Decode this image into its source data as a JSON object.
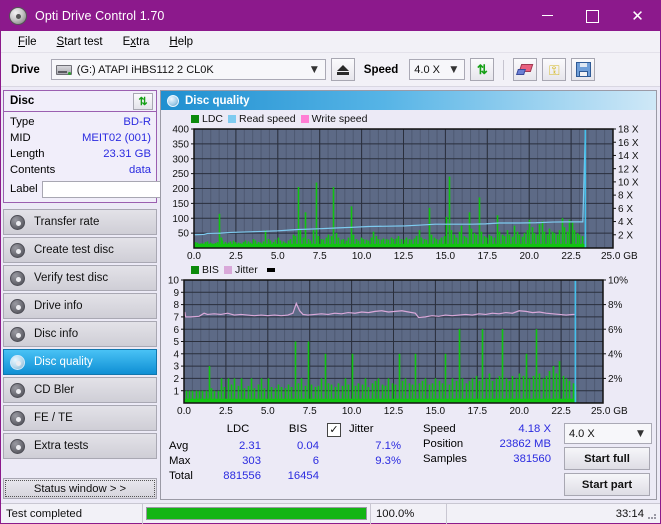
{
  "window": {
    "title": "Opti Drive Control 1.70",
    "icon": "disc-icon",
    "buttons": {
      "minimize": "minimize-icon",
      "maximize": "maximize-icon",
      "close": "✕"
    }
  },
  "menu": {
    "items": [
      "File",
      "Start test",
      "Extra",
      "Help"
    ]
  },
  "toolbar": {
    "drive_label": "Drive",
    "drive_value": "(G:)  ATAPI iHBS112  2 CL0K",
    "eject_icon": "eject-icon",
    "speed_label": "Speed",
    "speed_value": "4.0 X",
    "refresh_icon": "refresh-icon",
    "eraser_icon": "eraser-icon",
    "keys_icon": "keys-icon",
    "save_icon": "save-icon"
  },
  "sidebar": {
    "disc_panel": {
      "title": "Disc",
      "refresh_icon": "refresh-icon",
      "rows": [
        {
          "key": "Type",
          "value": "BD-R"
        },
        {
          "key": "MID",
          "value": "MEIT02 (001)"
        },
        {
          "key": "Length",
          "value": "23.31 GB"
        },
        {
          "key": "Contents",
          "value": "data"
        }
      ],
      "label_key": "Label",
      "label_value": "",
      "label_placeholder": "",
      "label_button_icon": "disc-icon"
    },
    "nav": [
      {
        "label": "Transfer rate",
        "active": false
      },
      {
        "label": "Create test disc",
        "active": false
      },
      {
        "label": "Verify test disc",
        "active": false
      },
      {
        "label": "Drive info",
        "active": false
      },
      {
        "label": "Disc info",
        "active": false
      },
      {
        "label": "Disc quality",
        "active": true
      },
      {
        "label": "CD Bler",
        "active": false
      },
      {
        "label": "FE / TE",
        "active": false
      },
      {
        "label": "Extra tests",
        "active": false
      }
    ],
    "status_window_button": "Status window > >"
  },
  "main": {
    "header_title": "Disc quality",
    "header_icon": "disc-quality-icon"
  },
  "stats": {
    "col_headers": [
      "LDC",
      "BIS"
    ],
    "jitter_label": "Jitter",
    "jitter_checked": true,
    "jitter_check_glyph": "✓",
    "rows": [
      {
        "label": "Avg",
        "ldc": "2.31",
        "bis": "0.04",
        "jitter": "7.1%"
      },
      {
        "label": "Max",
        "ldc": "303",
        "bis": "6",
        "jitter": "9.3%"
      },
      {
        "label": "Total",
        "ldc": "881556",
        "bis": "16454",
        "jitter": ""
      }
    ],
    "speed_label": "Speed",
    "speed_value": "4.18 X",
    "position_label": "Position",
    "position_value": "23862 MB",
    "samples_label": "Samples",
    "samples_value": "381560",
    "speed_select": "4.0 X",
    "start_full": "Start full",
    "start_part": "Start part"
  },
  "statusbar": {
    "message": "Test completed",
    "percent_text": "100.0%",
    "progress": 100,
    "elapsed": "33:14"
  },
  "colors": {
    "titlebar": "#8c198c",
    "accent_blue": "#2b2be0",
    "ldc_green": "#11c411",
    "read_speed": "#7ecbf0",
    "write_speed": "#ff7ed4",
    "jitter_pink": "#d9a8d9",
    "plot_bg": "#5d6a86",
    "progress_green": "#14b514"
  },
  "chart_data": [
    {
      "type": "line",
      "name": "ldc-chart",
      "title": "",
      "legend": [
        {
          "label": "LDC",
          "color": "#0c8a0c"
        },
        {
          "label": "Read speed",
          "color": "#7ecbf0"
        },
        {
          "label": "Write speed",
          "color": "#ff7ed4"
        }
      ],
      "legend_position": "top-left",
      "xlabel": "GB",
      "ylabel": "LDC",
      "y2label": "X",
      "xlim": [
        0,
        25
      ],
      "ylim": [
        0,
        400
      ],
      "y2lim": [
        0,
        18
      ],
      "xticks": [
        0.0,
        2.5,
        5.0,
        7.5,
        10.0,
        12.5,
        15.0,
        17.5,
        20.0,
        22.5,
        25.0
      ],
      "xticklabels": [
        "0.0",
        "2.5",
        "5.0",
        "7.5",
        "10.0",
        "12.5",
        "15.0",
        "17.5",
        "20.0",
        "22.5",
        "25.0 GB"
      ],
      "yticks": [
        50,
        100,
        150,
        200,
        250,
        300,
        350,
        400
      ],
      "y2ticks": [
        2,
        4,
        6,
        8,
        10,
        12,
        14,
        16,
        18
      ],
      "y2ticklabels": [
        "2 X",
        "4 X",
        "6 X",
        "8 X",
        "10 X",
        "12 X",
        "14 X",
        "16 X",
        "18 X"
      ],
      "grid": true,
      "series": [
        {
          "name": "LDC",
          "kind": "impulse",
          "color": "#11c411",
          "x": [
            0.05,
            0.2,
            0.35,
            0.5,
            0.65,
            0.8,
            0.95,
            1.1,
            1.25,
            1.4,
            1.5,
            1.6,
            1.7,
            1.85,
            2.0,
            2.15,
            2.3,
            2.45,
            2.6,
            2.75,
            2.9,
            3.05,
            3.2,
            3.35,
            3.5,
            3.65,
            3.8,
            3.95,
            4.1,
            4.25,
            4.4,
            4.55,
            4.7,
            4.85,
            5.0,
            5.15,
            5.3,
            5.45,
            5.6,
            5.75,
            5.9,
            6.05,
            6.2,
            6.35,
            6.5,
            6.65,
            6.8,
            6.95,
            7.1,
            7.25,
            7.4,
            7.55,
            7.7,
            7.85,
            8.0,
            8.15,
            8.3,
            8.45,
            8.6,
            8.75,
            8.9,
            9.05,
            9.2,
            9.35,
            9.5,
            9.65,
            9.8,
            9.95,
            10.1,
            10.25,
            10.4,
            10.55,
            10.7,
            10.85,
            11.0,
            11.15,
            11.3,
            11.45,
            11.6,
            11.75,
            11.9,
            12.05,
            12.2,
            12.35,
            12.5,
            12.65,
            12.8,
            12.95,
            13.1,
            13.25,
            13.4,
            13.55,
            13.7,
            13.85,
            14.0,
            14.15,
            14.3,
            14.45,
            14.6,
            14.75,
            14.9,
            15.05,
            15.2,
            15.35,
            15.5,
            15.65,
            15.8,
            15.95,
            16.1,
            16.25,
            16.4,
            16.55,
            16.7,
            16.85,
            17.0,
            17.15,
            17.3,
            17.45,
            17.6,
            17.75,
            17.9,
            18.05,
            18.2,
            18.35,
            18.5,
            18.65,
            18.8,
            18.95,
            19.1,
            19.25,
            19.4,
            19.55,
            19.7,
            19.85,
            20.0,
            20.15,
            20.3,
            20.45,
            20.6,
            20.75,
            20.9,
            21.05,
            21.2,
            21.35,
            21.5,
            21.65,
            21.8,
            21.95,
            22.1,
            22.25,
            22.4,
            22.55,
            22.7,
            22.85,
            23.0,
            23.15,
            23.3
          ],
          "y": [
            20,
            18,
            15,
            16,
            20,
            22,
            18,
            15,
            17,
            20,
            115,
            35,
            25,
            20,
            18,
            22,
            25,
            20,
            18,
            16,
            20,
            25,
            22,
            18,
            30,
            25,
            20,
            18,
            22,
            60,
            30,
            25,
            20,
            28,
            35,
            25,
            22,
            18,
            25,
            30,
            45,
            40,
            205,
            60,
            35,
            120,
            30,
            25,
            60,
            220,
            40,
            30,
            28,
            35,
            45,
            40,
            205,
            50,
            35,
            28,
            30,
            25,
            35,
            140,
            45,
            30,
            25,
            35,
            30,
            28,
            25,
            35,
            55,
            40,
            30,
            28,
            32,
            30,
            28,
            35,
            30,
            32,
            40,
            30,
            28,
            35,
            30,
            28,
            32,
            40,
            60,
            35,
            30,
            28,
            135,
            45,
            35,
            30,
            28,
            35,
            40,
            105,
            240,
            60,
            45,
            35,
            55,
            75,
            40,
            35,
            120,
            65,
            50,
            45,
            170,
            55,
            40,
            35,
            45,
            40,
            35,
            110,
            55,
            45,
            40,
            60,
            45,
            38,
            75,
            55,
            45,
            38,
            50,
            60,
            95,
            70,
            50,
            45,
            80,
            90,
            55,
            45,
            65,
            55,
            50,
            45,
            60,
            100,
            70,
            55,
            95,
            85,
            60,
            50,
            45,
            40,
            35
          ]
        },
        {
          "name": "Read speed",
          "kind": "line",
          "color": "#7ecbf0",
          "axis": "y2",
          "x": [
            0.0,
            0.6,
            0.8,
            1.6,
            2.2,
            3.4,
            5.0,
            6.2,
            7.4,
            8.6,
            9.6,
            10.4,
            11.6,
            12.6,
            13.4,
            14.4,
            15.6,
            16.6,
            17.4,
            18.2,
            19.4,
            20.4,
            21.4,
            22.2,
            23.2,
            23.35
          ],
          "y": [
            2.0,
            2.05,
            2.2,
            2.25,
            2.35,
            2.45,
            2.6,
            2.8,
            2.9,
            3.05,
            3.15,
            3.25,
            3.3,
            3.35,
            3.45,
            3.6,
            3.6,
            3.6,
            3.65,
            3.78,
            3.78,
            3.82,
            3.92,
            3.95,
            3.95,
            18.0
          ]
        }
      ],
      "cursor_x": 23.35,
      "cursor_color": "#45c0ea"
    },
    {
      "type": "line",
      "name": "bis-jitter-chart",
      "title": "",
      "legend": [
        {
          "label": "BIS",
          "color": "#0c8a0c"
        },
        {
          "label": "Jitter",
          "color": "#d9a8d9"
        }
      ],
      "legend_position": "top-left",
      "xlabel": "GB",
      "ylabel": "BIS",
      "y2label": "%",
      "xlim": [
        0,
        25
      ],
      "ylim": [
        0,
        10
      ],
      "y2lim": [
        0,
        10
      ],
      "xticks": [
        0.0,
        2.5,
        5.0,
        7.5,
        10.0,
        12.5,
        15.0,
        17.5,
        20.0,
        22.5,
        25.0
      ],
      "xticklabels": [
        "0.0",
        "2.5",
        "5.0",
        "7.5",
        "10.0",
        "12.5",
        "15.0",
        "17.5",
        "20.0",
        "22.5",
        "25.0 GB"
      ],
      "yticks": [
        1,
        2,
        3,
        4,
        5,
        6,
        7,
        8,
        9,
        10
      ],
      "y2ticks": [
        2,
        4,
        6,
        8,
        10
      ],
      "y2ticklabels": [
        "2%",
        "4%",
        "6%",
        "8%",
        "10%"
      ],
      "grid": true,
      "series": [
        {
          "name": "BIS",
          "kind": "impulse",
          "color": "#11c411",
          "x": [
            0.1,
            0.3,
            0.5,
            0.7,
            0.9,
            1.1,
            1.3,
            1.5,
            1.6,
            1.8,
            2.0,
            2.2,
            2.4,
            2.6,
            2.8,
            3.0,
            3.2,
            3.4,
            3.6,
            3.8,
            4.0,
            4.2,
            4.4,
            4.6,
            4.8,
            5.0,
            5.2,
            5.4,
            5.6,
            5.8,
            6.0,
            6.2,
            6.4,
            6.6,
            6.8,
            7.0,
            7.2,
            7.4,
            7.6,
            7.8,
            8.0,
            8.2,
            8.4,
            8.6,
            8.8,
            9.0,
            9.2,
            9.4,
            9.6,
            9.8,
            10.0,
            10.2,
            10.4,
            10.6,
            10.8,
            11.0,
            11.2,
            11.4,
            11.6,
            11.8,
            12.0,
            12.2,
            12.4,
            12.6,
            12.8,
            13.0,
            13.2,
            13.4,
            13.6,
            13.8,
            14.0,
            14.2,
            14.4,
            14.6,
            14.8,
            15.0,
            15.2,
            15.4,
            15.6,
            15.8,
            16.0,
            16.2,
            16.4,
            16.6,
            16.8,
            17.0,
            17.2,
            17.4,
            17.6,
            17.8,
            18.0,
            18.2,
            18.4,
            18.6,
            18.8,
            19.0,
            19.2,
            19.4,
            19.6,
            19.8,
            20.0,
            20.2,
            20.4,
            20.6,
            20.8,
            21.0,
            21.2,
            21.4,
            21.6,
            21.8,
            22.0,
            22.2,
            22.4,
            22.6,
            22.8,
            23.0,
            23.2,
            23.3
          ],
          "y": [
            1.0,
            1.0,
            1.0,
            1.0,
            1.0,
            1.0,
            1.0,
            3.0,
            1.2,
            1.0,
            1.0,
            2.0,
            1.3,
            2.0,
            1.5,
            2.0,
            1.4,
            2.0,
            1.2,
            1.4,
            2.0,
            1.2,
            1.5,
            2.0,
            1.2,
            2.0,
            1.3,
            1.2,
            1.5,
            1.3,
            1.2,
            1.5,
            1.3,
            5.0,
            1.6,
            2.0,
            1.4,
            5.0,
            1.5,
            1.3,
            1.4,
            2.0,
            4.0,
            1.6,
            1.5,
            1.3,
            1.6,
            1.4,
            2.0,
            1.5,
            4.0,
            1.4,
            1.6,
            1.5,
            2.0,
            1.3,
            1.6,
            1.8,
            2.0,
            1.5,
            1.4,
            2.0,
            1.6,
            1.5,
            4.0,
            1.8,
            2.0,
            1.6,
            1.5,
            4.0,
            1.6,
            1.8,
            2.0,
            1.5,
            1.6,
            2.0,
            1.8,
            1.6,
            4.0,
            1.5,
            2.0,
            1.8,
            6.0,
            2.0,
            1.6,
            1.8,
            2.0,
            2.2,
            1.8,
            6.0,
            2.0,
            2.4,
            1.8,
            2.0,
            2.2,
            6.0,
            2.0,
            1.8,
            2.2,
            2.0,
            2.4,
            2.2,
            4.0,
            2.0,
            2.2,
            6.0,
            2.4,
            2.0,
            2.2,
            2.6,
            3.0,
            2.4,
            3.4,
            2.2,
            2.0,
            1.8,
            1.6,
            1.4
          ]
        },
        {
          "name": "Jitter",
          "kind": "line",
          "color": "#d9a8d9",
          "axis": "y2",
          "x": [
            0.05,
            0.1,
            0.4,
            0.9,
            1.2,
            1.4,
            1.8,
            2.2,
            2.6,
            3.0,
            3.4,
            3.8,
            4.2,
            4.6,
            5.0,
            5.4,
            5.8,
            6.2,
            6.5,
            6.7,
            6.9,
            7.1,
            7.4,
            7.8,
            8.2,
            8.6,
            9.0,
            9.4,
            9.8,
            10.2,
            10.6,
            11.0,
            11.4,
            11.8,
            12.2,
            12.6,
            13.0,
            13.4,
            13.8,
            14.0,
            14.4,
            14.8,
            15.2,
            15.6,
            16.0,
            16.4,
            16.8,
            17.2,
            17.6,
            18.0,
            18.4,
            18.8,
            19.2,
            19.6,
            20.0,
            20.4,
            20.8,
            21.2,
            21.6,
            22.0,
            22.4,
            22.8,
            23.2,
            23.3
          ],
          "y": [
            7.4,
            7.0,
            7.0,
            7.05,
            7.3,
            7.2,
            7.25,
            7.2,
            7.3,
            7.15,
            7.2,
            7.15,
            7.1,
            7.15,
            7.1,
            7.15,
            7.1,
            7.15,
            7.3,
            8.1,
            7.5,
            7.2,
            7.15,
            7.2,
            7.25,
            7.2,
            7.3,
            7.25,
            7.35,
            7.3,
            7.4,
            7.35,
            7.45,
            7.5,
            7.4,
            7.45,
            7.5,
            7.4,
            7.3,
            6.95,
            7.0,
            7.1,
            7.05,
            7.15,
            7.1,
            7.15,
            7.2,
            7.15,
            7.25,
            7.2,
            7.3,
            7.25,
            7.35,
            7.3,
            7.5,
            7.45,
            7.35,
            7.4,
            7.3,
            7.25,
            7.2,
            7.15,
            7.2,
            7.2
          ]
        }
      ],
      "cursor_x": 23.35,
      "cursor_color": "#45c0ea"
    }
  ]
}
